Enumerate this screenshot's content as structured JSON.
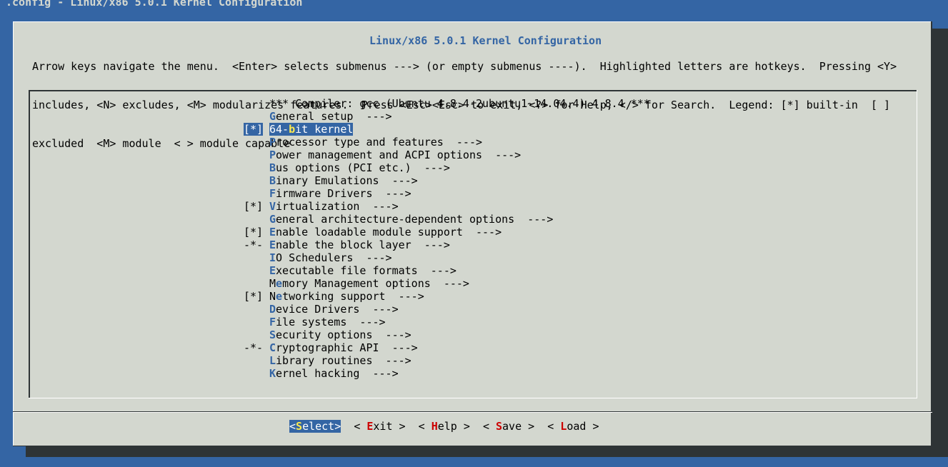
{
  "window_title": ".config - Linux/x86 5.0.1 Kernel Configuration",
  "dialog_title": "Linux/x86 5.0.1 Kernel Configuration",
  "help_lines": [
    "Arrow keys navigate the menu.  <Enter> selects submenus ---> (or empty submenus ----).  Highlighted letters are hotkeys.  Pressing <Y>",
    "includes, <N> excludes, <M> modularizes features.  Press <Esc><Esc> to exit, <?> for Help, </> for Search.  Legend: [*] built-in  [ ]",
    "excluded  <M> module  < > module capable"
  ],
  "menu": [
    {
      "prefix": "",
      "hot": "",
      "rest": "*** Compiler: gcc (Ubuntu 4.8.4-2ubuntu1~14.04.4) 4.8.4 ***",
      "selected": false
    },
    {
      "prefix": "",
      "hot": "G",
      "rest": "eneral setup  --->",
      "selected": false
    },
    {
      "prefix": "[*]",
      "hot": "",
      "pre": "64-",
      "hotmid": "b",
      "rest": "it kernel",
      "selected": true
    },
    {
      "prefix": "",
      "hot": "P",
      "rest": "rocessor type and features  --->",
      "selected": false
    },
    {
      "prefix": "",
      "hot": "P",
      "rest": "ower management and ACPI options  --->",
      "selected": false
    },
    {
      "prefix": "",
      "hot": "B",
      "rest": "us options (PCI etc.)  --->",
      "selected": false
    },
    {
      "prefix": "",
      "hot": "B",
      "rest": "inary Emulations  --->",
      "selected": false
    },
    {
      "prefix": "",
      "hot": "F",
      "rest": "irmware Drivers  --->",
      "selected": false
    },
    {
      "prefix": "[*]",
      "hot": "V",
      "rest": "irtualization  --->",
      "selected": false
    },
    {
      "prefix": "",
      "hot": "G",
      "rest": "eneral architecture-dependent options  --->",
      "selected": false
    },
    {
      "prefix": "[*]",
      "hot": "E",
      "rest": "nable loadable module support  --->",
      "selected": false
    },
    {
      "prefix": "-*-",
      "hot": "E",
      "rest": "nable the block layer  --->",
      "selected": false
    },
    {
      "prefix": "",
      "hot": "I",
      "rest": "O Schedulers  --->",
      "selected": false
    },
    {
      "prefix": "",
      "hot": "E",
      "rest": "xecutable file formats  --->",
      "selected": false
    },
    {
      "prefix": "",
      "hot": "",
      "pre": "M",
      "hotmid": "e",
      "rest": "mory Management options  --->",
      "selected": false
    },
    {
      "prefix": "[*]",
      "hot": "",
      "pre": "N",
      "hotmid": "e",
      "rest": "tworking support  --->",
      "selected": false
    },
    {
      "prefix": "",
      "hot": "D",
      "rest": "evice Drivers  --->",
      "selected": false
    },
    {
      "prefix": "",
      "hot": "F",
      "rest": "ile systems  --->",
      "selected": false
    },
    {
      "prefix": "",
      "hot": "S",
      "rest": "ecurity options  --->",
      "selected": false
    },
    {
      "prefix": "-*-",
      "hot": "C",
      "rest": "ryptographic API  --->",
      "selected": false
    },
    {
      "prefix": "",
      "hot": "L",
      "rest": "ibrary routines  --->",
      "selected": false
    },
    {
      "prefix": "",
      "hot": "K",
      "rest": "ernel hacking  --->",
      "selected": false
    }
  ],
  "buttons": [
    {
      "open": "<",
      "hot": "S",
      "rest": "elect",
      "close": ">",
      "active": true,
      "name": "select-button"
    },
    {
      "open": "< ",
      "hot": "E",
      "rest": "xit",
      "close": " >",
      "active": false,
      "name": "exit-button"
    },
    {
      "open": "< ",
      "hot": "H",
      "rest": "elp",
      "close": " >",
      "active": false,
      "name": "help-button"
    },
    {
      "open": "< ",
      "hot": "S",
      "rest": "ave",
      "close": " >",
      "active": false,
      "name": "save-button"
    },
    {
      "open": "< ",
      "hot": "L",
      "rest": "oad",
      "close": " >",
      "active": false,
      "name": "load-button"
    }
  ],
  "colors": {
    "background": "#3465a4",
    "dialog": "#d3d7cf",
    "highlight": "#3465a4",
    "hotkey_button": "#cc0000",
    "hotkey_selected": "#fce94f"
  }
}
